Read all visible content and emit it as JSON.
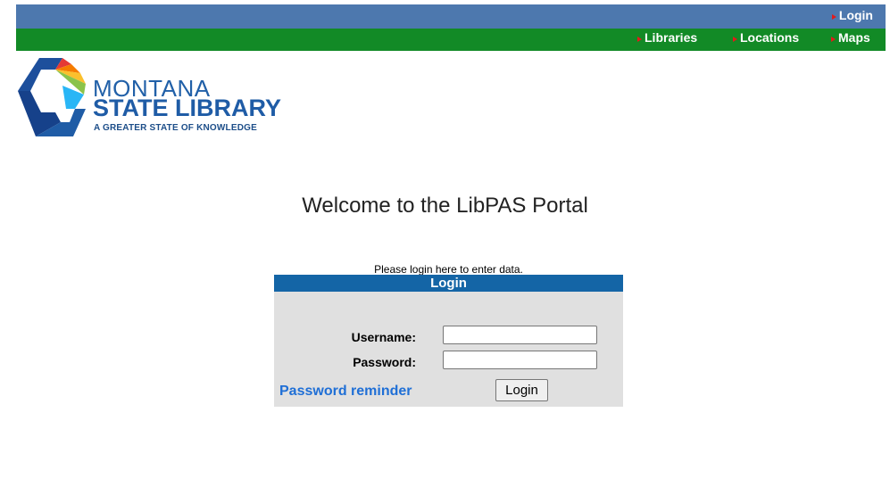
{
  "topbar": {
    "login_link": "Login"
  },
  "navbar": {
    "items": [
      {
        "label": "Libraries"
      },
      {
        "label": "Locations"
      },
      {
        "label": "Maps"
      }
    ]
  },
  "logo": {
    "line1": "MONTANA",
    "line2": "STATE LIBRARY",
    "tagline": "A GREATER STATE OF KNOWLEDGE"
  },
  "main": {
    "welcome": "Welcome to the LibPAS Portal",
    "hint": "Please login here to enter data."
  },
  "login_form": {
    "header": "Login",
    "username_label": "Username:",
    "username_value": "",
    "password_label": "Password:",
    "password_value": "",
    "reminder_link": "Password reminder",
    "submit_label": "Login"
  },
  "colors": {
    "topbar": "#4d78ae",
    "navbar": "#128a26",
    "panel_header": "#1465a6",
    "panel_bg": "#e0e0e0",
    "link": "#1f6fd6",
    "arrow": "#e11b1b"
  }
}
